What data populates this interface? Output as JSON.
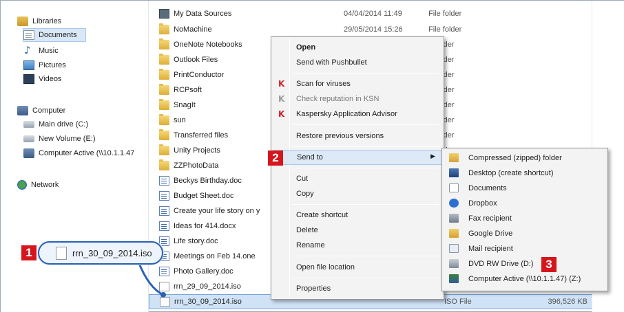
{
  "nav": {
    "items": [
      {
        "label": "Libraries",
        "icon": "library-icon"
      },
      {
        "label": "Documents",
        "icon": "documents-icon",
        "selected": true
      },
      {
        "label": "Music",
        "icon": "music-icon"
      },
      {
        "label": "Pictures",
        "icon": "pictures-icon"
      },
      {
        "label": "Videos",
        "icon": "videos-icon"
      },
      {
        "label": "Computer",
        "icon": "computer-icon"
      },
      {
        "label": "Main drive (C:)",
        "icon": "drive-icon"
      },
      {
        "label": "New Volume (E:)",
        "icon": "drive-icon"
      },
      {
        "label": "Computer Active (\\\\10.1.1.47",
        "icon": "network-drive-icon"
      },
      {
        "label": "Network",
        "icon": "network-icon"
      }
    ]
  },
  "files": {
    "rows": [
      {
        "name": "My Data Sources",
        "date": "04/04/2014 11:49",
        "type": "File folder",
        "size": "",
        "icon": "data-sources-icon"
      },
      {
        "name": "NoMachine",
        "date": "29/05/2014 15:26",
        "type": "File folder",
        "size": "",
        "icon": "folder-icon"
      },
      {
        "name": "OneNote Notebooks",
        "date": "",
        "type": "folder",
        "size": "",
        "icon": "folder-icon"
      },
      {
        "name": "Outlook Files",
        "date": "",
        "type": "folder",
        "size": "",
        "icon": "folder-icon"
      },
      {
        "name": "PrintConductor",
        "date": "",
        "type": "folder",
        "size": "",
        "icon": "folder-icon"
      },
      {
        "name": "RCPsoft",
        "date": "",
        "type": "folder",
        "size": "",
        "icon": "folder-icon"
      },
      {
        "name": "SnagIt",
        "date": "",
        "type": "folder",
        "size": "",
        "icon": "folder-icon"
      },
      {
        "name": "sun",
        "date": "",
        "type": "folder",
        "size": "",
        "icon": "folder-icon"
      },
      {
        "name": "Transferred files",
        "date": "",
        "type": "folder",
        "size": "",
        "icon": "folder-icon"
      },
      {
        "name": "Unity Projects",
        "date": "",
        "type": "folder",
        "size": "",
        "icon": "folder-icon"
      },
      {
        "name": "ZZPhotoData",
        "date": "",
        "type": "",
        "size": "",
        "icon": "folder-icon"
      },
      {
        "name": "Beckys Birthday.doc",
        "date": "",
        "type": "",
        "size": "",
        "icon": "word-doc-icon"
      },
      {
        "name": "Budget Sheet.doc",
        "date": "",
        "type": "",
        "size": "",
        "icon": "word-doc-icon"
      },
      {
        "name": "Create your life story on y",
        "date": "",
        "type": "",
        "size": "",
        "icon": "word-doc-icon"
      },
      {
        "name": "Ideas for 414.docx",
        "date": "",
        "type": "",
        "size": "",
        "icon": "word-doc-icon"
      },
      {
        "name": "Life story.doc",
        "date": "",
        "type": "",
        "size": "",
        "icon": "word-doc-icon"
      },
      {
        "name": "Meetings on Feb 14.one",
        "date": "",
        "type": "",
        "size": "",
        "icon": "onenote-icon"
      },
      {
        "name": "Photo Gallery.doc",
        "date": "",
        "type": "",
        "size": "",
        "icon": "word-doc-icon"
      },
      {
        "name": "rrn_29_09_2014.iso",
        "date": "",
        "type": "",
        "size": "",
        "icon": "blank-file-icon"
      },
      {
        "name": "rrn_30_09_2014.iso",
        "date": "",
        "type": "ISO File",
        "size": "396,526 KB",
        "icon": "blank-file-icon",
        "highlighted": true
      }
    ]
  },
  "context_menu": {
    "items": [
      {
        "label": "Open",
        "bold": true
      },
      {
        "label": "Send with Pushbullet"
      },
      {
        "sep": true
      },
      {
        "label": "Scan for viruses",
        "icon": "kaspersky-icon"
      },
      {
        "label": "Check reputation in KSN",
        "icon": "kaspersky-icon",
        "disabled": true
      },
      {
        "label": "Kaspersky Application Advisor",
        "icon": "kaspersky-icon"
      },
      {
        "sep": true
      },
      {
        "label": "Restore previous versions"
      },
      {
        "sep": true
      },
      {
        "label": "Send to",
        "submenu": true,
        "active": true
      },
      {
        "sep": true
      },
      {
        "label": "Cut"
      },
      {
        "label": "Copy"
      },
      {
        "sep": true
      },
      {
        "label": "Create shortcut"
      },
      {
        "label": "Delete"
      },
      {
        "label": "Rename"
      },
      {
        "sep": true
      },
      {
        "label": "Open file location"
      },
      {
        "sep": true
      },
      {
        "label": "Properties"
      }
    ]
  },
  "send_to_menu": {
    "items": [
      {
        "label": "Compressed (zipped) folder",
        "icon": "zip-folder-icon"
      },
      {
        "label": "Desktop (create shortcut)",
        "icon": "desktop-icon"
      },
      {
        "label": "Documents",
        "icon": "documents-icon"
      },
      {
        "label": "Dropbox",
        "icon": "dropbox-icon"
      },
      {
        "label": "Fax recipient",
        "icon": "fax-icon"
      },
      {
        "label": "Google Drive",
        "icon": "google-drive-icon"
      },
      {
        "label": "Mail recipient",
        "icon": "mail-icon"
      },
      {
        "label": "DVD RW Drive (D:)",
        "icon": "dvd-drive-icon"
      },
      {
        "label": "Computer Active (\\\\10.1.1.47) (Z:)",
        "icon": "network-drive-icon"
      }
    ]
  },
  "drag_item": {
    "label": "rrn_30_09_2014.iso"
  },
  "callouts": {
    "one": "1",
    "two": "2",
    "three": "3"
  },
  "colors": {
    "callout": "#d6161d",
    "selection": "#cfe2f6",
    "connector": "#2b62b3"
  }
}
